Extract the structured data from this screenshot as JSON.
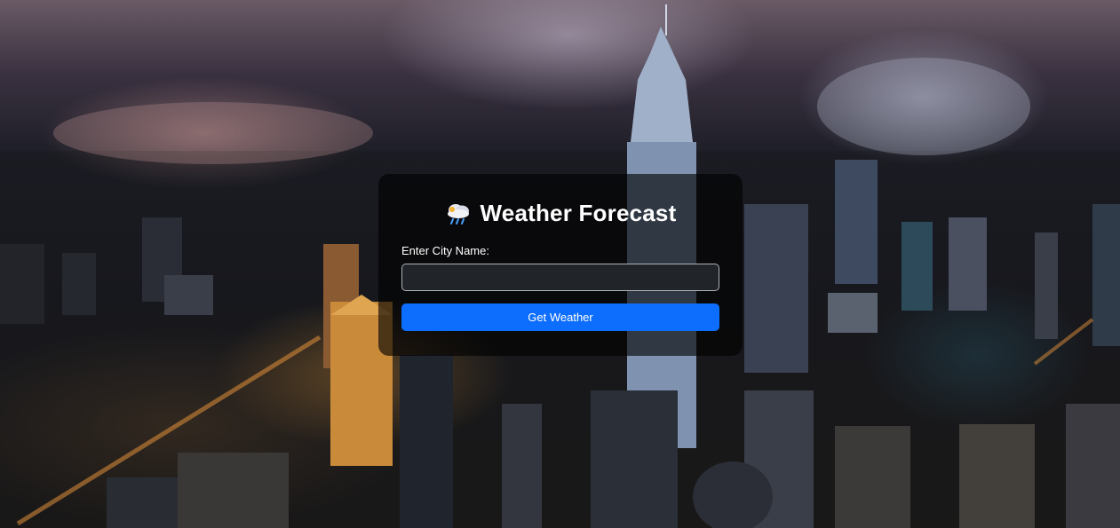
{
  "header": {
    "title": "Weather Forecast",
    "icon": "cloud-rain-icon"
  },
  "form": {
    "city_label": "Enter City Name:",
    "city_value": "",
    "city_placeholder": "",
    "submit_label": "Get Weather"
  },
  "colors": {
    "button": "#0d6efd",
    "input_bg": "#212529",
    "card_bg": "rgba(0,0,0,0.62)"
  }
}
